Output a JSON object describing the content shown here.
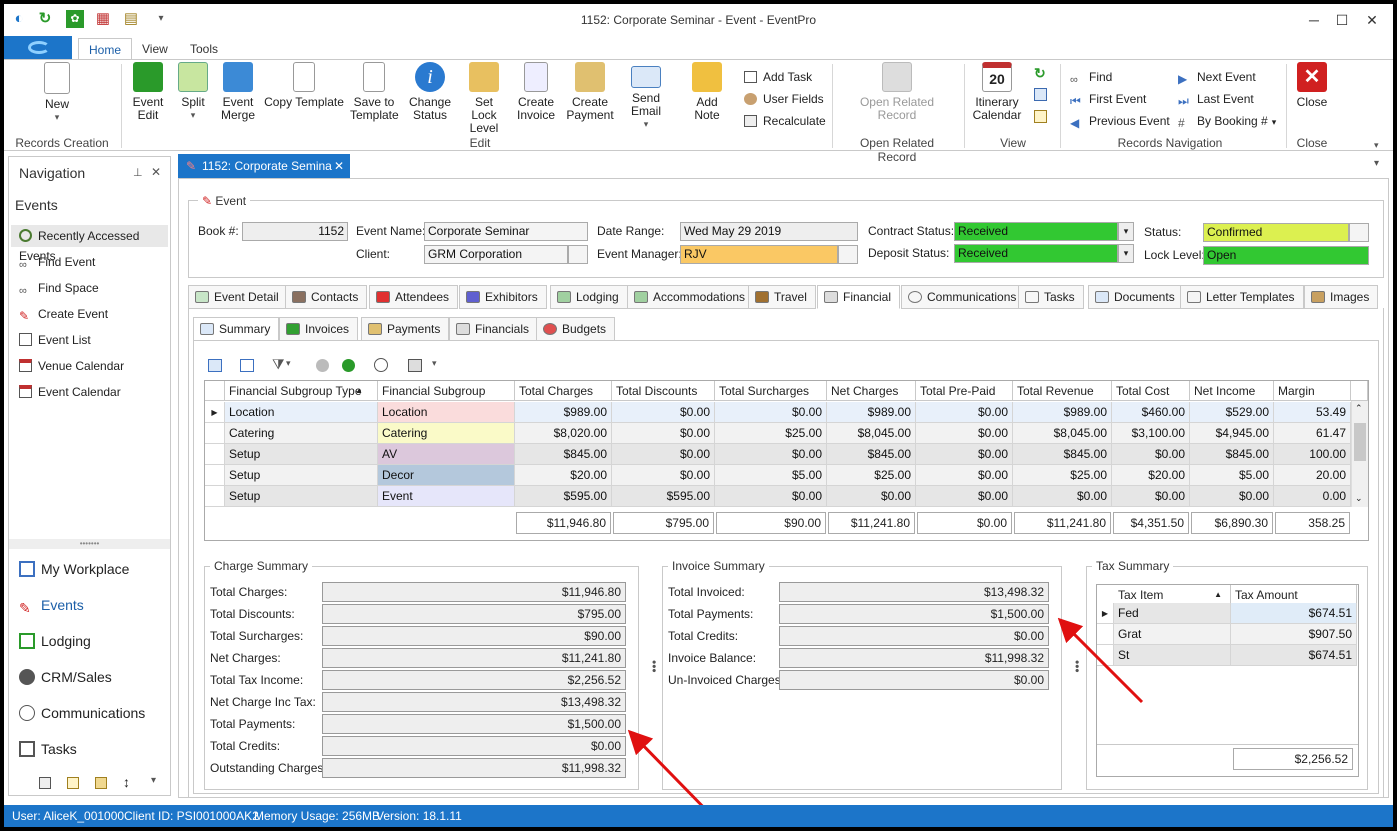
{
  "window": {
    "title": "1152: Corporate Seminar - Event - EventPro"
  },
  "ribbon": {
    "tabs": [
      "Home",
      "View",
      "Tools"
    ],
    "groups": {
      "records_creation": "Records Creation",
      "edit": "Edit",
      "open_related": "Open Related Record",
      "view": "View",
      "records_navigation": "Records Navigation",
      "close": "Close"
    },
    "buttons": {
      "new": "New",
      "event_edit_1": "Event",
      "event_edit_2": "Edit",
      "split": "Split",
      "event_merge_1": "Event",
      "event_merge_2": "Merge",
      "copy_template": "Copy Template",
      "save_template_1": "Save to",
      "save_template_2": "Template",
      "change_status_1": "Change",
      "change_status_2": "Status",
      "set_lock_1": "Set Lock",
      "set_lock_2": "Level",
      "create_invoice_1": "Create",
      "create_invoice_2": "Invoice",
      "create_payment_1": "Create",
      "create_payment_2": "Payment",
      "send_email": "Send Email",
      "add_note": "Add Note",
      "add_task": "Add Task",
      "user_fields": "User Fields",
      "recalculate": "Recalculate",
      "open_related_1": "Open Related",
      "open_related_2": "Record",
      "itinerary_1": "Itinerary",
      "itinerary_2": "Calendar",
      "find": "Find",
      "first_event": "First Event",
      "previous_event": "Previous Event",
      "next_event": "Next Event",
      "last_event": "Last Event",
      "by_booking": "By Booking #",
      "close": "Close"
    }
  },
  "nav": {
    "title": "Navigation",
    "section": "Events",
    "items": [
      "Recently Accessed Events",
      "Find Event",
      "Find Space",
      "Create Event",
      "Event List",
      "Venue Calendar",
      "Event Calendar"
    ],
    "modules": [
      "My Workplace",
      "Events",
      "Lodging",
      "CRM/Sales",
      "Communications",
      "Tasks"
    ]
  },
  "doc_tab": "1152: Corporate Semina",
  "event": {
    "header": "Event",
    "book_label": "Book #:",
    "book": "1152",
    "name_label": "Event Name:",
    "name": "Corporate Seminar",
    "client_label": "Client:",
    "client": "GRM Corporation",
    "date_label": "Date Range:",
    "date": "Wed May 29 2019",
    "manager_label": "Event Manager:",
    "manager": "RJV",
    "contract_label": "Contract Status:",
    "contract": "Received",
    "deposit_label": "Deposit Status:",
    "deposit": "Received",
    "status_label": "Status:",
    "status": "Confirmed",
    "lock_label": "Lock Level:",
    "lock": "Open"
  },
  "tabs": [
    "Event Detail",
    "Contacts",
    "Attendees",
    "Exhibitors",
    "Lodging",
    "Accommodations",
    "Travel",
    "Financial",
    "Communications",
    "Tasks",
    "Documents",
    "Letter Templates",
    "Images"
  ],
  "subtabs": [
    "Summary",
    "Invoices",
    "Payments",
    "Financials",
    "Budgets"
  ],
  "grid": {
    "columns": [
      "Financial Subgroup Type",
      "Financial Subgroup",
      "Total Charges",
      "Total Discounts",
      "Total Surcharges",
      "Net Charges",
      "Total Pre-Paid",
      "Total Revenue",
      "Total Cost",
      "Net Income",
      "Margin"
    ],
    "rows": [
      [
        "Location",
        "Location",
        "$989.00",
        "$0.00",
        "$0.00",
        "$989.00",
        "$0.00",
        "$989.00",
        "$460.00",
        "$529.00",
        "53.49"
      ],
      [
        "Catering",
        "Catering",
        "$8,020.00",
        "$0.00",
        "$25.00",
        "$8,045.00",
        "$0.00",
        "$8,045.00",
        "$3,100.00",
        "$4,945.00",
        "61.47"
      ],
      [
        "Setup",
        "AV",
        "$845.00",
        "$0.00",
        "$0.00",
        "$845.00",
        "$0.00",
        "$845.00",
        "$0.00",
        "$845.00",
        "100.00"
      ],
      [
        "Setup",
        "Decor",
        "$20.00",
        "$0.00",
        "$5.00",
        "$25.00",
        "$0.00",
        "$25.00",
        "$20.00",
        "$5.00",
        "20.00"
      ],
      [
        "Setup",
        "Event",
        "$595.00",
        "$595.00",
        "$0.00",
        "$0.00",
        "$0.00",
        "$0.00",
        "$0.00",
        "$0.00",
        "0.00"
      ]
    ],
    "subgroup_colors": [
      "#fadcdc",
      "#fafac8",
      "#dcc8dc",
      "#b4c8dc",
      "#e6e6fa"
    ],
    "totals": [
      "$11,946.80",
      "$795.00",
      "$90.00",
      "$11,241.80",
      "$0.00",
      "$11,241.80",
      "$4,351.50",
      "$6,890.30",
      "358.25"
    ]
  },
  "charge_summary": {
    "title": "Charge Summary",
    "items": [
      {
        "label": "Total Charges:",
        "value": "$11,946.80"
      },
      {
        "label": "Total Discounts:",
        "value": "$795.00"
      },
      {
        "label": "Total Surcharges:",
        "value": "$90.00"
      },
      {
        "label": "Net Charges:",
        "value": "$11,241.80"
      },
      {
        "label": "Total Tax Income:",
        "value": "$2,256.52"
      },
      {
        "label": "Net Charge Inc Tax:",
        "value": "$13,498.32"
      },
      {
        "label": "Total Payments:",
        "value": "$1,500.00"
      },
      {
        "label": "Total Credits:",
        "value": "$0.00"
      },
      {
        "label": "Outstanding Charges:",
        "value": "$11,998.32"
      }
    ]
  },
  "invoice_summary": {
    "title": "Invoice Summary",
    "items": [
      {
        "label": "Total Invoiced:",
        "value": "$13,498.32"
      },
      {
        "label": "Total Payments:",
        "value": "$1,500.00"
      },
      {
        "label": "Total Credits:",
        "value": "$0.00"
      },
      {
        "label": "Invoice Balance:",
        "value": "$11,998.32"
      },
      {
        "label": "Un-Invoiced Charges:",
        "value": "$0.00"
      }
    ]
  },
  "tax_summary": {
    "title": "Tax Summary",
    "col_item": "Tax Item",
    "col_amount": "Tax Amount",
    "rows": [
      [
        "Fed",
        "$674.51"
      ],
      [
        "Grat",
        "$907.50"
      ],
      [
        "St",
        "$674.51"
      ]
    ],
    "total": "$2,256.52"
  },
  "status_bar": {
    "user": "User: AliceK_001000",
    "client": "Client ID: PSI001000AK2",
    "memory": "Memory Usage: 256MB",
    "version": "Version: 18.1.11"
  },
  "colors": {
    "accent": "#1c75c9",
    "green": "#32c832",
    "yellow": "#dcf050",
    "orange": "#fac864",
    "arrow": "#e01010"
  }
}
